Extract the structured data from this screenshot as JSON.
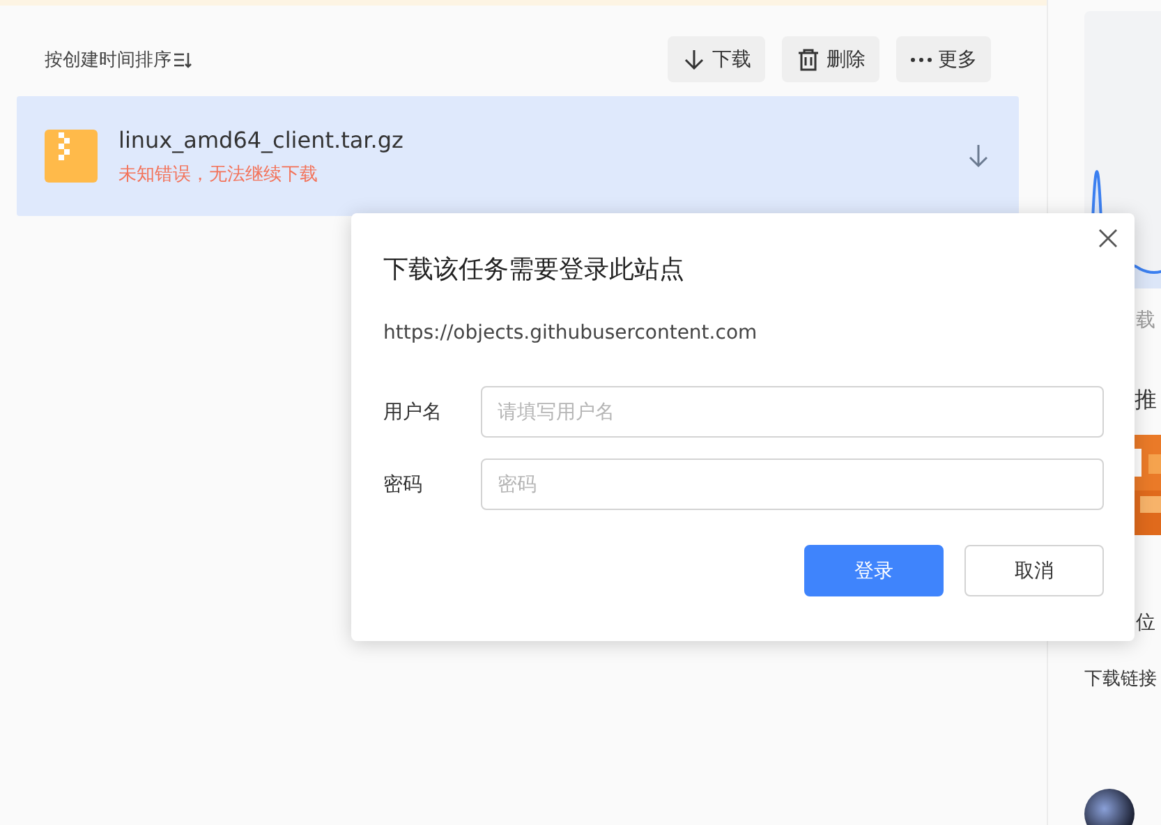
{
  "toolbar": {
    "sort_label": "按创建时间排序",
    "buttons": [
      {
        "label": "下载",
        "kind": "download"
      },
      {
        "label": "删除",
        "kind": "delete"
      },
      {
        "label": "更多",
        "kind": "more"
      }
    ]
  },
  "files": [
    {
      "name": "linux_amd64_client.tar.gz",
      "error": "未知错误，无法继续下载",
      "selected": true
    }
  ],
  "side_panel": {
    "text_1": "载",
    "text_2": "推",
    "text_3": "位",
    "text_4": "下载链接"
  },
  "dialog": {
    "title": "下载该任务需要登录此站点",
    "url": "https://objects.githubusercontent.com",
    "fields": [
      {
        "label": "用户名",
        "placeholder": "请填写用户名"
      },
      {
        "label": "密码",
        "placeholder": "密码"
      }
    ],
    "buttons": [
      {
        "label": "登录",
        "kind": "primary"
      },
      {
        "label": "取消",
        "kind": "secondary"
      }
    ]
  }
}
